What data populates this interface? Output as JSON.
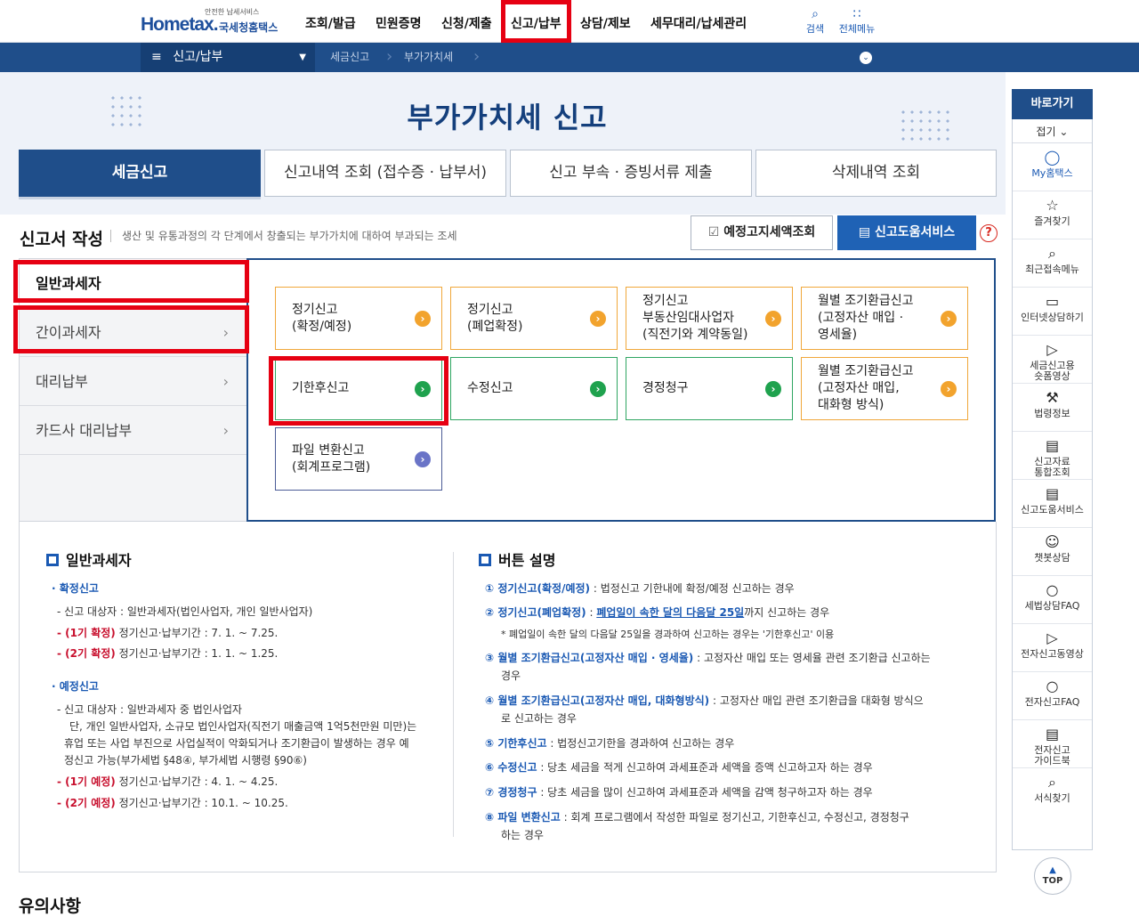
{
  "header": {
    "logo_small": "안전한 납세서비스",
    "logo_brand": "Hometax.",
    "logo_org": "국세청홈택스",
    "menu": [
      "조회/발급",
      "민원증명",
      "신청/제출",
      "신고/납부",
      "상담/제보",
      "세무대리/납세관리"
    ],
    "search_label": "검색",
    "allmenu_label": "전체메뉴"
  },
  "subnav": {
    "current": "신고/납부",
    "crumbs": [
      "세금신고",
      "부가가치세"
    ]
  },
  "page": {
    "title": "부가가치세 신고",
    "tabs": [
      "세금신고",
      "신고내역 조회 (접수증 · 납부서)",
      "신고 부속 · 증빙서류 제출",
      "삭제내역 조회"
    ],
    "section_title": "신고서 작성",
    "section_desc": "생산 및 유통과정의 각 단계에서 창출되는 부가가치에 대하여 부과되는 조세",
    "btn_notice_tax": "예정고지세액조회",
    "btn_help_service": "신고도움서비스",
    "help_mark": "?"
  },
  "taxpayer_types": [
    "일반과세자",
    "간이과세자",
    "대리납부",
    "카드사 대리납부"
  ],
  "cards": [
    [
      "정기신고",
      "(확정/예정)"
    ],
    [
      "정기신고",
      "(폐업확정)"
    ],
    [
      "정기신고",
      "부동산임대사업자",
      "(직전기와 계약동일)"
    ],
    [
      "월별 조기환급신고",
      "(고정자산 매입 ·",
      "영세율)"
    ],
    [
      "기한후신고"
    ],
    [
      "수정신고"
    ],
    [
      "경정청구"
    ],
    [
      "월별 조기환급신고",
      "(고정자산 매입,",
      "대화형 방식)"
    ],
    [
      "파일 변환신고",
      "(회계프로그램)"
    ]
  ],
  "info_left": {
    "heading": "일반과세자",
    "confirm_title": "확정신고",
    "confirm_target": "신고 대상자 : 일반과세자(법인사업자, 개인 일반사업자)",
    "confirm_p1_tag": "(1기 확정)",
    "confirm_p1": "정기신고·납부기간 : 7. 1. ~ 7.25.",
    "confirm_p2_tag": "(2기 확정)",
    "confirm_p2": "정기신고·납부기간 : 1. 1. ~ 1.25.",
    "prelim_title": "예정신고",
    "prelim_target": "신고 대상자 : 일반과세자 중 법인사업자",
    "prelim_l2": "단, 개인 일반사업자, 소규모 법인사업자(직전기 매출금액 1억5천만원 미만)는",
    "prelim_l3": "휴업 또는 사업 부진으로 사업실적이 악화되거나 조기환급이 발생하는 경우 예",
    "prelim_l4": "정신고 가능(부가세법 §48④, 부가세법 시행령 §90⑥)",
    "prelim_p1_tag": "(1기 예정)",
    "prelim_p1": "정기신고·납부기간 : 4. 1. ~ 4.25.",
    "prelim_p2_tag": "(2기 예정)",
    "prelim_p2": "정기신고·납부기간 : 10.1. ~ 10.25."
  },
  "info_right": {
    "heading": "버튼 설명",
    "i1_b": "① 정기신고(확정/예정)",
    "i1": " : 법정신고 기한내에 확정/예정 신고하는 경우",
    "i2_b": "② 정기신고(폐업확정)",
    "i2_sep": " : ",
    "i2_u": "폐업일이 속한 달의 다음달 25일",
    "i2": "까지 신고하는 경우",
    "i2_note": "* 폐업일이 속한 달의 다음달 25일을 경과하여 신고하는 경우는 '기한후신고' 이용",
    "i3_b": "③ 월별 조기환급신고(고정자산 매입 · 영세율)",
    "i3": " : 고정자산 매입 또는 영세율 관련 조기환급 신고하는",
    "i3_2": "경우",
    "i4_b": "④ 월별 조기환급신고(고정자산 매입, 대화형방식)",
    "i4": " : 고정자산 매입 관련 조기환급을 대화형 방식으",
    "i4_2": "로 신고하는 경우",
    "i5_b": "⑤ 기한후신고",
    "i5": " : 법정신고기한을 경과하여 신고하는 경우",
    "i6_b": "⑥ 수정신고",
    "i6": " : 당초 세금을 적게 신고하여 과세표준과 세액을 증액 신고하고자 하는 경우",
    "i7_b": "⑦ 경정청구",
    "i7": " : 당초 세금을 많이 신고하여 과세표준과 세액을 감액 청구하고자 하는 경우",
    "i8_b": "⑧ 파일 변환신고",
    "i8": " : 회계 프로그램에서 작성한 파일로 정기신고, 기한후신고, 수정신고, 경정청구",
    "i8_2": "하는 경우"
  },
  "quick": {
    "title": "바로가기",
    "collapse": "접기",
    "items": [
      [
        "My홈택스"
      ],
      [
        "즐겨찾기"
      ],
      [
        "최근접속메뉴"
      ],
      [
        "인터넷상담하기"
      ],
      [
        "세금신고용",
        "숏폼영상"
      ],
      [
        "법령정보"
      ],
      [
        "신고자료",
        "통합조회"
      ],
      [
        "신고도움서비스"
      ],
      [
        "챗봇상담"
      ],
      [
        "세법상담FAQ"
      ],
      [
        "전자신고동영상"
      ],
      [
        "전자신고FAQ"
      ],
      [
        "전자신고",
        "가이드북"
      ],
      [
        "서식찾기"
      ]
    ],
    "top": "TOP"
  },
  "notice_title": "유의사항"
}
